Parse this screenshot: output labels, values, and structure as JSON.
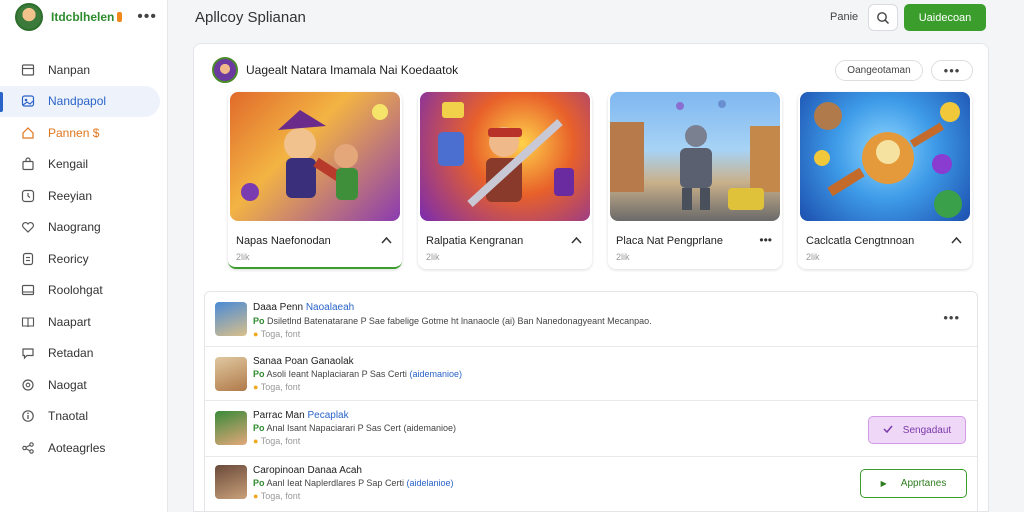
{
  "app": {
    "name": "Itdcblhelen",
    "more_icon": "ellipsis-icon"
  },
  "sidebar": {
    "items": [
      {
        "label": "Nanpan",
        "icon": "list-icon"
      },
      {
        "label": "Nandpapol",
        "icon": "image-icon"
      },
      {
        "label": "Pannen $",
        "icon": "home-icon"
      },
      {
        "label": "Kengail",
        "icon": "bag-icon"
      },
      {
        "label": "Reeyian",
        "icon": "clock-icon"
      },
      {
        "label": "Naograng",
        "icon": "heart-icon"
      },
      {
        "label": "Reoricy",
        "icon": "document-icon"
      },
      {
        "label": "Roolohgat",
        "icon": "window-icon"
      },
      {
        "label": "Naapart",
        "icon": "book-icon"
      },
      {
        "label": "Retadan",
        "icon": "chat-icon"
      },
      {
        "label": "Naogat",
        "icon": "settings-icon"
      },
      {
        "label": "Tnaotal",
        "icon": "info-icon"
      },
      {
        "label": "Aoteagrles",
        "icon": "share-icon"
      }
    ]
  },
  "header": {
    "title": "Apllcoy Splianan",
    "link": "Panie",
    "primary_button": "Uaidecoan"
  },
  "feed": {
    "title": "Uagealt Natara Imamala Nai Koedaatok",
    "sort_label": "Oangeotaman",
    "more_label": "•••"
  },
  "games": [
    {
      "name": "Napas Naefonodan",
      "meta": "2lik",
      "action": "^"
    },
    {
      "name": "Ralpatia Kengranan",
      "meta": "2lik",
      "action": "^"
    },
    {
      "name": "Placa Nat Pengprlane",
      "meta": "2lik",
      "action": "•••"
    },
    {
      "name": "Caclcatla Cengtnnoan",
      "meta": "2lik",
      "action": "^"
    }
  ],
  "comments": [
    {
      "name": "Daaa Penn",
      "tag": "Naoalaeah",
      "prefix": "Po",
      "text": "Dsiletlnd Batenatarane P Sae fabelige Gotme ht lnanaocle (ai) Ban Nanedonagyeant Mecanpao.",
      "highlight": "",
      "rating": "Toga, font",
      "action": "more"
    },
    {
      "name": "Sanaa Poan",
      "tag": "Ganaolak",
      "prefix": "Po",
      "text": "Asoli Ieant Naplaciaran P Sas Certi",
      "highlight": "(aidemanioe)",
      "rating": "Toga, font",
      "action": "none"
    },
    {
      "name": "Parrac Man",
      "tag": "Pecaplak",
      "prefix": "Po",
      "text": "Anal Isant Napaciarari P Sas Cert",
      "highlight": "(aidemanioe)",
      "rating": "Toga, font",
      "action": "suggest",
      "action_label": "Sengadaut"
    },
    {
      "name": "Caropinoan",
      "tag": "Danaa Acah",
      "prefix": "Po",
      "text": "Aanl Ieat Naplerdlares P Sap Certi",
      "highlight": "(aidelanioe)",
      "rating": "Toga, font",
      "action": "approve",
      "action_label": "Apprtanes"
    }
  ],
  "colors": {
    "accent": "#3b9e2c",
    "link": "#2a64c8",
    "warning": "#e0761c",
    "suggest": "#efd7f7"
  }
}
